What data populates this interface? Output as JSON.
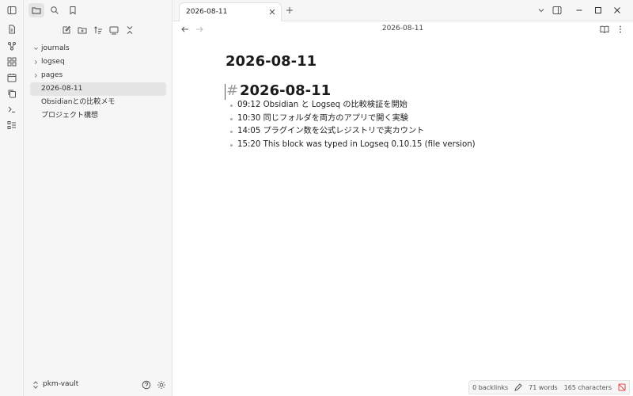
{
  "ribbon": {
    "icons": [
      "sidebar-toggle-icon",
      "file-icon",
      "graph-icon",
      "grid-icon",
      "calendar-icon",
      "copy-icon",
      "terminal-icon",
      "list-icon"
    ]
  },
  "sidebar": {
    "top_icons": [
      "folder-icon",
      "search-icon",
      "bookmark-icon"
    ],
    "tools": [
      "new-note-icon",
      "new-folder-icon",
      "sort-icon",
      "collapse-view-icon",
      "collapse-all-icon"
    ],
    "tree": [
      {
        "label": "journals",
        "kind": "folder",
        "expanded": true
      },
      {
        "label": "logseq",
        "kind": "folder",
        "expanded": false
      },
      {
        "label": "pages",
        "kind": "folder",
        "expanded": false
      },
      {
        "label": "2026-08-11",
        "kind": "file",
        "selected": true
      },
      {
        "label": "Obsidianとの比較メモ",
        "kind": "file"
      },
      {
        "label": "プロジェクト構想",
        "kind": "file"
      }
    ],
    "vault_name": "pkm-vault"
  },
  "tabs": [
    {
      "label": "2026-08-11",
      "active": true
    }
  ],
  "breadcrumb": "2026-08-11",
  "note": {
    "inline_title": "2026-08-11",
    "heading_marker": "#",
    "heading": "2026-08-11",
    "blocks": [
      "09:12 Obsidian と Logseq の比較検証を開始",
      "10:30 同じフォルダを両方のアプリで開く実験",
      "14:05 プラグイン数を公式レジストリで実カウント",
      "15:20 This block was typed in Logseq 0.10.15 (file version)"
    ]
  },
  "status": {
    "backlinks": "0 backlinks",
    "words": "71 words",
    "characters": "165 characters"
  },
  "colors": {
    "sidebar_bg": "#f6f6f6",
    "accent": "#e64a4a"
  }
}
